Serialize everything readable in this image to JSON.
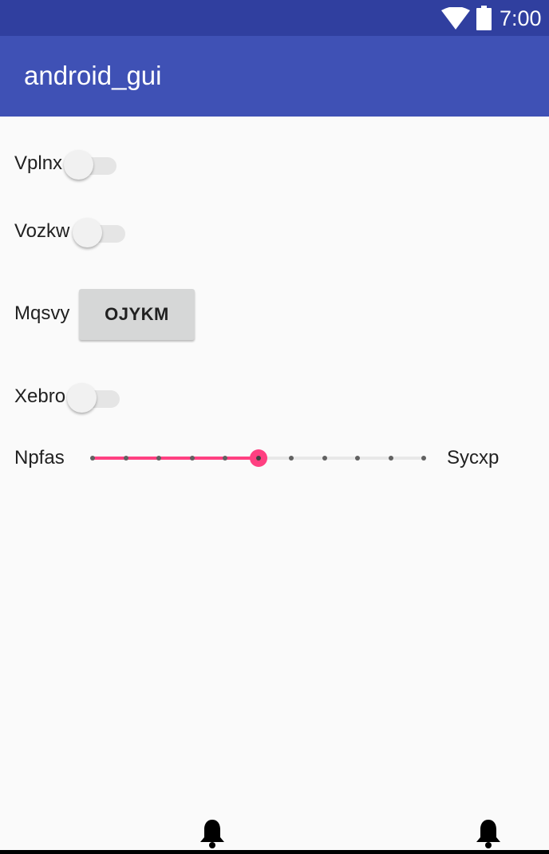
{
  "status_bar": {
    "time": "7:00",
    "wifi_icon": "wifi-icon",
    "battery_icon": "battery-icon",
    "background": "#303f9f"
  },
  "app_bar": {
    "title": "android_gui",
    "background": "#3f51b5"
  },
  "form": {
    "switch_1": {
      "label": "Vplnx",
      "checked": false
    },
    "switch_2": {
      "label": "Vozkw",
      "checked": false
    },
    "button_row": {
      "label": "Mqsvy",
      "button_label": "OJYKM"
    },
    "switch_3": {
      "label": "Xebro",
      "checked": false
    },
    "seekbar": {
      "label_start": "Npfas",
      "label_end": "Sycxp",
      "min": 0,
      "max": 10,
      "value": 5,
      "accent": "#ff4081"
    }
  },
  "bottom_bar": {
    "icons": [
      "bell-icon",
      "bell-icon"
    ]
  }
}
